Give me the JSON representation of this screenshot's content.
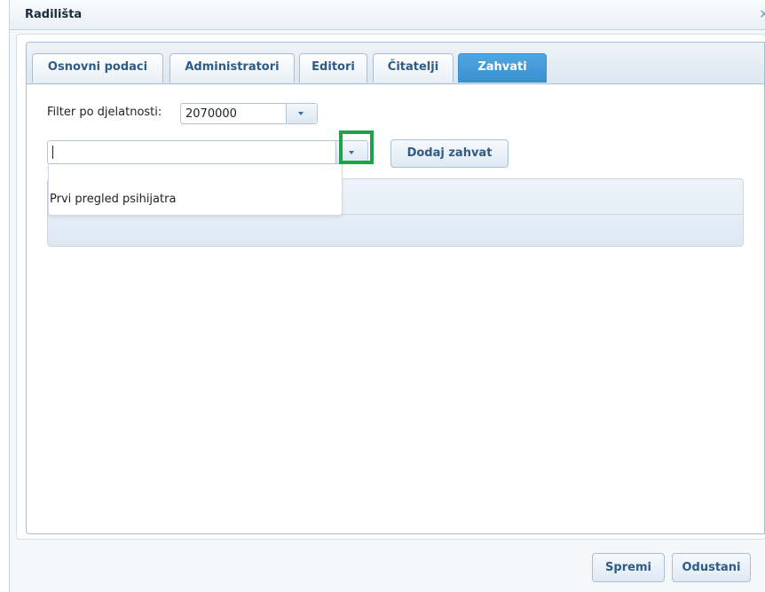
{
  "window": {
    "title": "Radilišta",
    "close_glyph": "×"
  },
  "tabs": [
    {
      "label": "Osnovni podaci",
      "active": false
    },
    {
      "label": "Administratori",
      "active": false
    },
    {
      "label": "Editori",
      "active": false
    },
    {
      "label": "Čitatelji",
      "active": false
    },
    {
      "label": "Zahvati",
      "active": true
    }
  ],
  "filter": {
    "label": "Filter po djelatnosti:",
    "value": "2070000"
  },
  "procedure_combo": {
    "value": "",
    "placeholder": ""
  },
  "add_button": {
    "label": "Dodaj zahvat"
  },
  "dropdown": {
    "items": [
      "Prvi pregled psihijatra"
    ]
  },
  "footer": {
    "save_label": "Spremi",
    "cancel_label": "Odustani"
  },
  "colors": {
    "accent": "#3a8fd0",
    "highlight": "#1fa34a",
    "tab_text": "#2f5b85"
  }
}
